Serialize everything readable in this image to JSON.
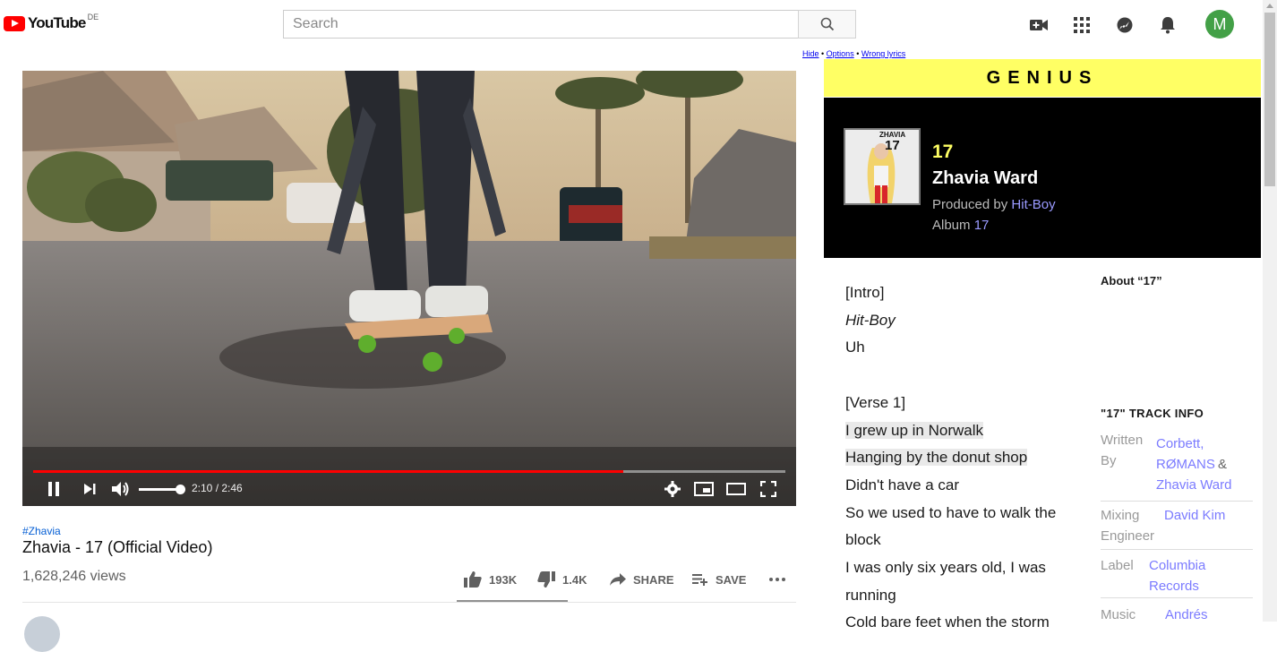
{
  "youtube": {
    "logo_text": "YouTube",
    "region": "DE",
    "search_placeholder": "Search",
    "avatar_initial": "M"
  },
  "player": {
    "current_time": "2:10",
    "duration": "2:46",
    "time_display": "2:10 / 2:46",
    "progress": 0.785
  },
  "video": {
    "hashtag": "#Zhavia",
    "title": "Zhavia - 17 (Official Video)",
    "views": "1,628,246 views",
    "likes": "193K",
    "dislikes": "1.4K",
    "share_label": "SHARE",
    "save_label": "SAVE"
  },
  "genius": {
    "links": [
      "Hide",
      "Options",
      "Wrong lyrics"
    ],
    "brand": "GENIUS",
    "song_title": "17",
    "artist": "Zhavia Ward",
    "produced_by_label": "Produced by",
    "producer": "Hit-Boy",
    "album_label": "Album",
    "album": "17",
    "cover_artist": "ZHAVIA",
    "cover_title": "17",
    "lyrics": [
      {
        "text": "[Intro]"
      },
      {
        "text": "Hit-Boy",
        "italic": true
      },
      {
        "text": "Uh"
      },
      {
        "text": ""
      },
      {
        "text": "[Verse 1]"
      },
      {
        "text": "I grew up in Norwalk",
        "highlight": true
      },
      {
        "text": "Hanging by the donut shop",
        "highlight": true
      },
      {
        "text": "Didn't have a car"
      },
      {
        "text": "So we used to have to walk the"
      },
      {
        "text": "block"
      },
      {
        "text": "I was only six years old, I was"
      },
      {
        "text": "running"
      },
      {
        "text": "Cold bare feet when the storm"
      }
    ],
    "about_heading": "About “17”",
    "track_info_heading": "\"17\" TRACK INFO",
    "track_info": {
      "written_label_1": "Written",
      "written_label_2": "By",
      "written_1": "Corbett,",
      "written_2": "RØMANS",
      "written_amp": "&",
      "written_3": "Zhavia Ward",
      "mixing_label_1": "Mixing",
      "mixing_label_2": "Engineer",
      "mixing": "David Kim",
      "label_label": "Label",
      "label_1": "Columbia",
      "label_2": "Records",
      "music_label": "Music",
      "music_1": "Andrés"
    }
  }
}
